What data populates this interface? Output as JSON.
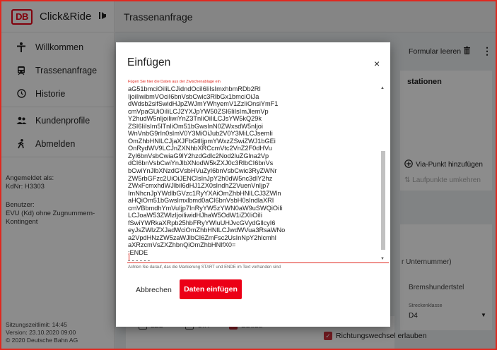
{
  "app": {
    "brand_logo": "DB",
    "brand_name": "Click&Ride",
    "collapse_icon": "collapse-left-icon"
  },
  "sidebar": {
    "items": [
      {
        "label": "Willkommen",
        "icon": "person-icon"
      },
      {
        "label": "Trassenanfrage",
        "icon": "train-icon"
      },
      {
        "label": "Historie",
        "icon": "clock-icon"
      },
      {
        "label": "Kundenprofile",
        "icon": "people-icon"
      },
      {
        "label": "Abmelden",
        "icon": "walk-icon"
      }
    ],
    "login_label": "Angemeldet als:",
    "login_value": "KdNr: H3303",
    "user_label": "Benutzer:",
    "user_value": "EVU (Kd) ohne Zugnummern-Kontingent",
    "session": "Sitzungszeitlimit: 14:45",
    "version": "Version: 23.10.2020 09:00",
    "copyright": "© 2020 Deutsche Bahn AG"
  },
  "main": {
    "title": "Trassenanfrage",
    "formular_leeren": "Formular leeren",
    "card_title_partial": "stationen",
    "via_punkt": "Via-Punkt hinzufügen",
    "laufpunkte": "Laufpunkte umkehren",
    "unternummer_partial": "r Unternummer)",
    "bremshundertstel": "Bremshundertstel",
    "streckenklasse_label": "Streckenklasse",
    "streckenklasse_value": "D4",
    "checkboxes": [
      {
        "label": "LZB",
        "checked": false
      },
      {
        "label": "CIR",
        "checked": false
      },
      {
        "label": "EBuLa",
        "checked": true
      }
    ],
    "richtungswechsel": "Richtungswechsel erlauben"
  },
  "dialog": {
    "title": "Einfügen",
    "close": "×",
    "hint": "Fügen Sie hier die Daten aus der Zwischenablage ein",
    "textarea_lines": [
      "aG51bmciOiIiLCJidndOciI6IiIsImxhbmRDb2RI",
      "IjoiIiwibmVOciI6bnVsbCwic3RlbGx1bmciOiJa",
      "dWdsb2sifSwidHJpZWJmYWhyemV1ZzIiOnsiYmF1",
      "cmVpaGUiOiIiLCJ2YXJpYW50ZSI6IiIsImJlemVp",
      "Y2hudW5nIjoiIiwiYnZ3TnIiOiIiLCJsYW5kQ29k",
      "ZSI6IiIsIm5lTnIiOm51bGwsInN0ZWxsdW5nIjoi",
      "WnVnbG9rIn0sImV0Y3MiOiJub2V0Y3MiLCJsemIi",
      "OmZhbHNlLCJjaXJFbGtlIjpmYWxzZSwiZWJ1bGEi",
      "OnRydWV9LCJnZXNhbXRCcmVtc2VnZ2F0dHVu",
      "ZyI6bnVsbCwiaG9lY2hzdGdlc2Nod2luZGlna2Vp",
      "dCI6bnVsbCwiYnJlbXNodW5kZXJ0c3RlbCI6bnVs",
      "bCwiYnJlbXNzdGVsbHVuZyI6bnVsbCwic3RyZWNr",
      "ZW5rbGFzc2UiOiJENCIsInJpY2h0dW5nc3dlY2hz",
      "ZWxFcmxhdWJlbiI6dHJ1ZX0sIndhZ2VuenVnIjp7",
      "ImNhcnJpYWdlbGVzc1RyYXAiOmZhbHNlLCJ3ZWln",
      "aHQiOm51bGwsImxlbmd0aCI6bnVsbH0sIndlaXRI",
      "cmVBbmdhYmVuIjp7InRyYW5zYWN0aW9uSWQiOiIi",
      "LCJoaW53ZWlzIjoiIiwidHJhaW5OdW1iZXIiOiIi",
      "fSwiYWRkaXRpb25hbFRyYWluUHJvcGVydGllcyI6",
      "eyJsZWlzZXJadWciOmZhbHNlLCJwdWVua3RsaWNo",
      "a2VpdHNzZW5zaWJlbCI6ZmFsc2UsInNpY2hlcmhl",
      "aXRzcmVsZXZhbnQiOmZhbHNlfX0=",
      ":ENDE",
      "- - - - - -"
    ],
    "hint_bottom": "Achten Sie darauf, das die Markierung START und ENDE im Text vorhanden sind",
    "cancel": "Abbrechen",
    "insert": "Daten einfügen"
  }
}
